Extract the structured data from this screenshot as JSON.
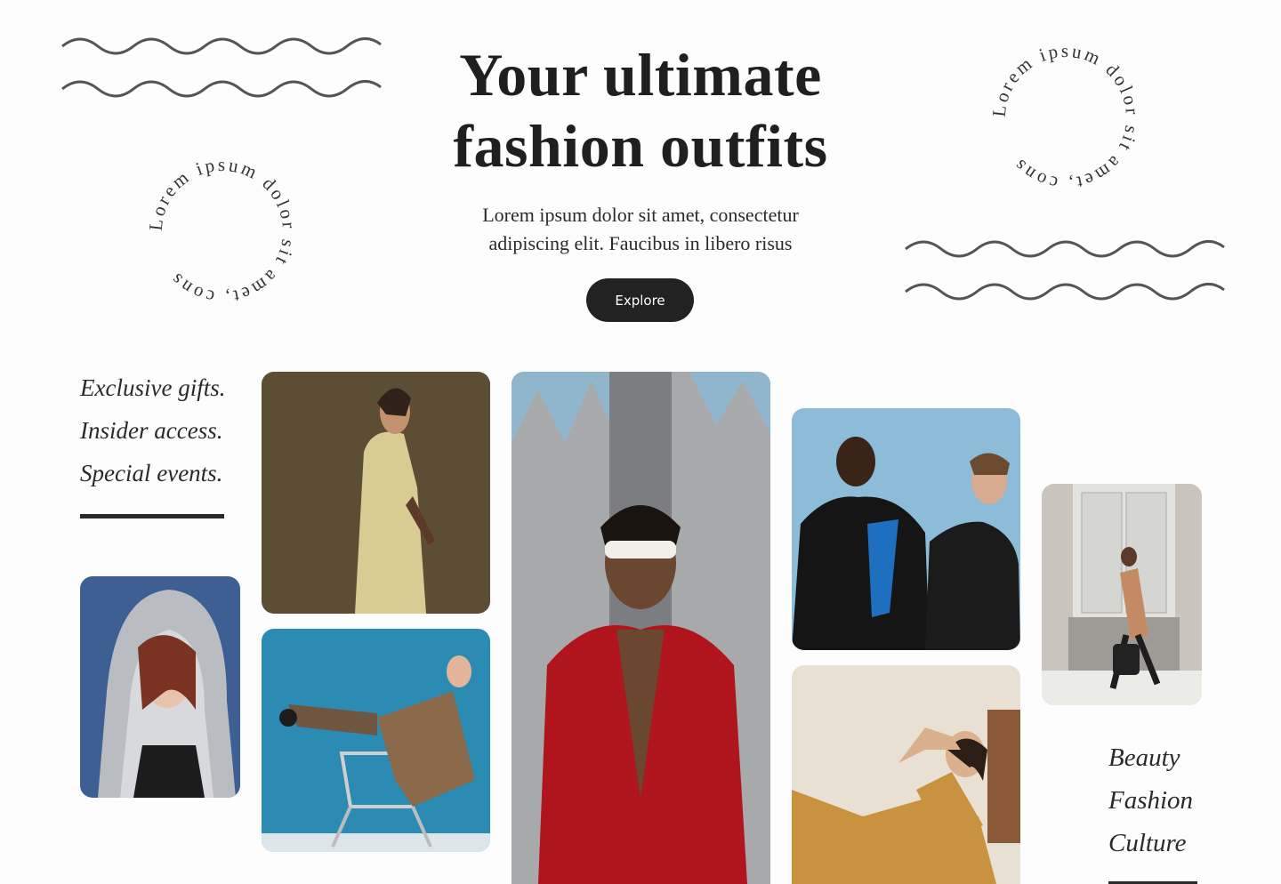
{
  "hero": {
    "title_line1": "Your ultimate",
    "title_line2": "fashion outfits",
    "subtitle_line1": "Lorem ipsum dolor sit amet, consectetur",
    "subtitle_line2": "adipiscing elit. Faucibus in libero risus",
    "cta_label": "Explore"
  },
  "circular_text": "Lorem ipsum dolor sit amet, cons",
  "taglines_left": [
    "Exclusive gifts.",
    "Insider access.",
    "Special events."
  ],
  "taglines_right": [
    "Beauty",
    "Fashion",
    "Culture"
  ],
  "colors": {
    "background": "#fdfdfd",
    "text": "#222222",
    "button": "#222222"
  }
}
